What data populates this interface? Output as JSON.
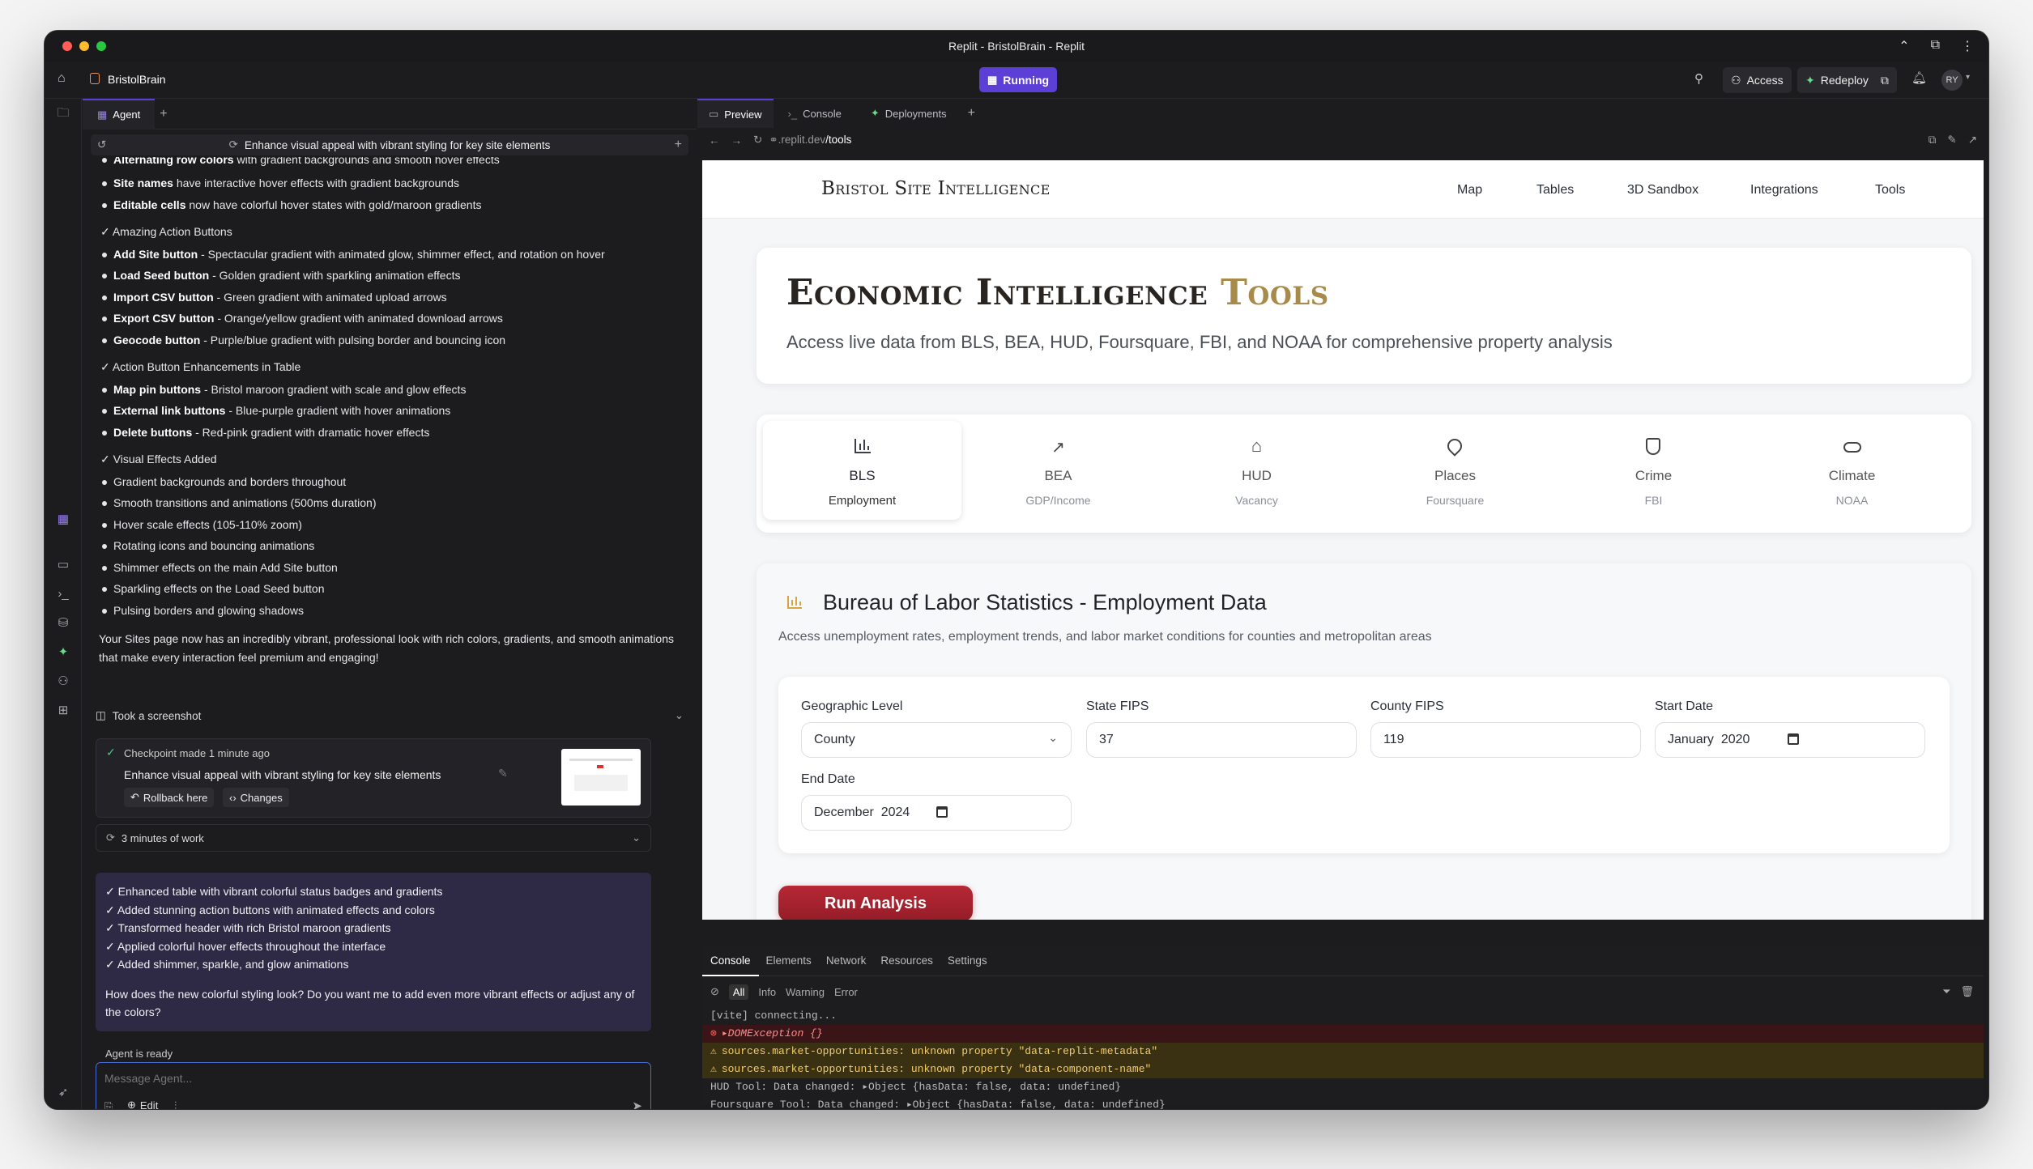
{
  "window": {
    "title": "Replit - BristolBrain - Replit"
  },
  "topbar": {
    "project_name": "BristolBrain",
    "status": "Running",
    "access_label": "Access",
    "redeploy_label": "Redeploy",
    "avatar_initials": "RY"
  },
  "agent_panel": {
    "tab_label": "Agent",
    "thread_title": "Enhance visual appeal with vibrant styling for key site elements",
    "cut_line": {
      "bold": "Alternating row colors",
      "text": " with gradient backgrounds and smooth hover effects"
    },
    "items_top": [
      {
        "bold": "Site names",
        "text": " have interactive hover effects with gradient backgrounds"
      },
      {
        "bold": "Editable cells",
        "text": " now have colorful hover states with gold/maroon gradients"
      }
    ],
    "section_buttons": "✓ Amazing Action Buttons",
    "items_buttons": [
      {
        "bold": "Add Site button",
        "text": " - Spectacular gradient with animated glow, shimmer effect, and rotation on hover"
      },
      {
        "bold": "Load Seed button",
        "text": " - Golden gradient with sparkling animation effects"
      },
      {
        "bold": "Import CSV button",
        "text": " - Green gradient with animated upload arrows"
      },
      {
        "bold": "Export CSV button",
        "text": " - Orange/yellow gradient with animated download arrows"
      },
      {
        "bold": "Geocode button",
        "text": " - Purple/blue gradient with pulsing border and bouncing icon"
      }
    ],
    "section_table": "✓ Action Button Enhancements in Table",
    "items_table": [
      {
        "bold": "Map pin buttons",
        "text": " - Bristol maroon gradient with scale and glow effects"
      },
      {
        "bold": "External link buttons",
        "text": " - Blue-purple gradient with hover animations"
      },
      {
        "bold": "Delete buttons",
        "text": " - Red-pink gradient with dramatic hover effects"
      }
    ],
    "section_effects": "✓ Visual Effects Added",
    "items_effects": [
      "Gradient backgrounds and borders throughout",
      "Smooth transitions and animations (500ms duration)",
      "Hover scale effects (105-110% zoom)",
      "Rotating icons and bouncing animations",
      "Shimmer effects on the main Add Site button",
      "Sparkling effects on the Load Seed button",
      "Pulsing borders and glowing shadows"
    ],
    "summary": "Your Sites page now has an incredibly vibrant, professional look with rich colors, gradients, and smooth animations that make every interaction feel premium and engaging!",
    "screenshot_label": "Took a screenshot",
    "checkpoint": {
      "label": "Checkpoint made 1 minute ago",
      "title": "Enhance visual appeal with vibrant styling for key site elements",
      "rollback": "Rollback here",
      "changes": "Changes"
    },
    "work_label": "3 minutes of work",
    "message_items": [
      "✓ Enhanced table with vibrant colorful status badges and gradients",
      "✓ Added stunning action buttons with animated effects and colors",
      "✓ Transformed header with rich Bristol maroon gradients",
      "✓ Applied colorful hover effects throughout the interface",
      "✓ Added shimmer, sparkle, and glow animations"
    ],
    "message_question": "How does the new colorful styling look? Do you want me to add even more vibrant effects or adjust any of the colors?",
    "status": "Agent is ready",
    "input_placeholder": "Message Agent...",
    "edit_label": "Edit"
  },
  "preview_tabs": {
    "preview": "Preview",
    "console": "Console",
    "deployments": "Deployments"
  },
  "url": {
    "host": ".replit.dev",
    "path": "/tools"
  },
  "site": {
    "brand": "Bristol Site Intelligence",
    "nav": [
      "Map",
      "Tables",
      "3D Sandbox",
      "Integrations",
      "Tools"
    ],
    "hero_title_part1": "Economic Intelligence",
    "hero_title_part2": "Tools",
    "hero_subtitle": "Access live data from BLS, BEA, HUD, Foursquare, FBI, and NOAA for comprehensive property analysis",
    "data_tabs": [
      {
        "label": "BLS",
        "sub": "Employment",
        "icon": "bar-chart-icon"
      },
      {
        "label": "BEA",
        "sub": "GDP/Income",
        "icon": "trending-up-icon"
      },
      {
        "label": "HUD",
        "sub": "Vacancy",
        "icon": "home-icon"
      },
      {
        "label": "Places",
        "sub": "Foursquare",
        "icon": "map-pin-icon"
      },
      {
        "label": "Crime",
        "sub": "FBI",
        "icon": "shield-icon"
      },
      {
        "label": "Climate",
        "sub": "NOAA",
        "icon": "cloud-icon"
      }
    ],
    "section_title": "Bureau of Labor Statistics - Employment Data",
    "section_subtitle": "Access unemployment rates, employment trends, and labor market conditions for counties and metropolitan areas",
    "form": {
      "geo_label": "Geographic Level",
      "geo_value": "County",
      "state_label": "State FIPS",
      "state_value": "37",
      "county_label": "County FIPS",
      "county_value": "119",
      "start_label": "Start Date",
      "start_value": "January  2020",
      "end_label": "End Date",
      "end_value": "December  2024"
    },
    "run_button": "Run Analysis"
  },
  "devtools": {
    "tabs": [
      "Console",
      "Elements",
      "Network",
      "Resources",
      "Settings"
    ],
    "filters": [
      "All",
      "Info",
      "Warning",
      "Error"
    ],
    "logs": [
      {
        "type": "info",
        "text": "[vite] connecting..."
      },
      {
        "type": "error",
        "text": "▸DOMException {}"
      },
      {
        "type": "warn",
        "text": "sources.market-opportunities: unknown property \"data-replit-metadata\""
      },
      {
        "type": "warn",
        "text": "sources.market-opportunities: unknown property \"data-component-name\""
      },
      {
        "type": "info",
        "text": "HUD Tool: Data changed: ▸Object {hasData: false, data: undefined}"
      },
      {
        "type": "info",
        "text": "Foursquare Tool: Data changed: ▸Object {hasData: false, data: undefined}"
      }
    ]
  },
  "colors": {
    "brand_maroon": "#a4232f",
    "gold": "#a88b4a",
    "running_purple": "#5b3fd6"
  }
}
